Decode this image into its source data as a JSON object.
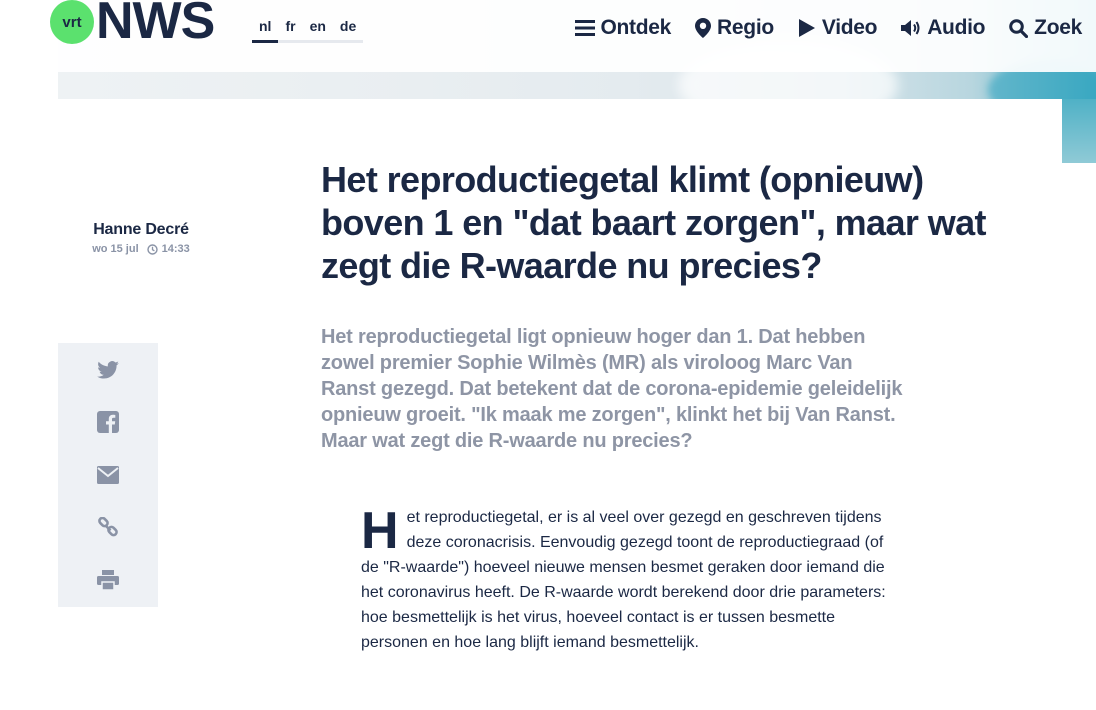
{
  "logo": {
    "badge": "vrt",
    "wordmark": "NWS"
  },
  "languages": [
    {
      "code": "nl",
      "active": true
    },
    {
      "code": "fr",
      "active": false
    },
    {
      "code": "en",
      "active": false
    },
    {
      "code": "de",
      "active": false
    }
  ],
  "nav": {
    "ontdek": "Ontdek",
    "regio": "Regio",
    "video": "Video",
    "audio": "Audio",
    "zoek": "Zoek"
  },
  "colors": {
    "brand_green": "#5be16e",
    "navy": "#1b2844",
    "intro_gray": "#8e95a5",
    "share_bg": "#eef1f5"
  },
  "article": {
    "author": "Hanne Decré",
    "date": "wo 15 jul",
    "time": "14:33",
    "title": "Het reproductiegetal klimt (opnieuw) boven 1 en \"dat baart zorgen\", maar wat zegt die R-waarde nu precies?",
    "intro": "Het reproductiegetal ligt opnieuw hoger dan 1. Dat hebben zowel premier Sophie Wilmès (MR) als viroloog Marc Van Ranst gezegd. Dat betekent dat de corona-epidemie geleidelijk opnieuw groeit. \"Ik maak me zorgen\", klinkt het bij Van Ranst. Maar wat zegt die R-waarde nu precies?",
    "dropcap": "H",
    "body": "et reproductiegetal, er is al veel over gezegd en geschreven tijdens deze coronacrisis. Eenvoudig gezegd toont de reproductiegraad (of de \"R-waarde\") hoeveel nieuwe mensen besmet geraken door iemand die het coronavirus heeft. De R-waarde wordt berekend door drie parameters: hoe besmettelijk is het virus, hoeveel contact is er tussen besmette personen en hoe lang blijft iemand besmettelijk."
  },
  "share_icons": [
    "twitter-icon",
    "facebook-icon",
    "email-icon",
    "link-icon",
    "print-icon"
  ]
}
